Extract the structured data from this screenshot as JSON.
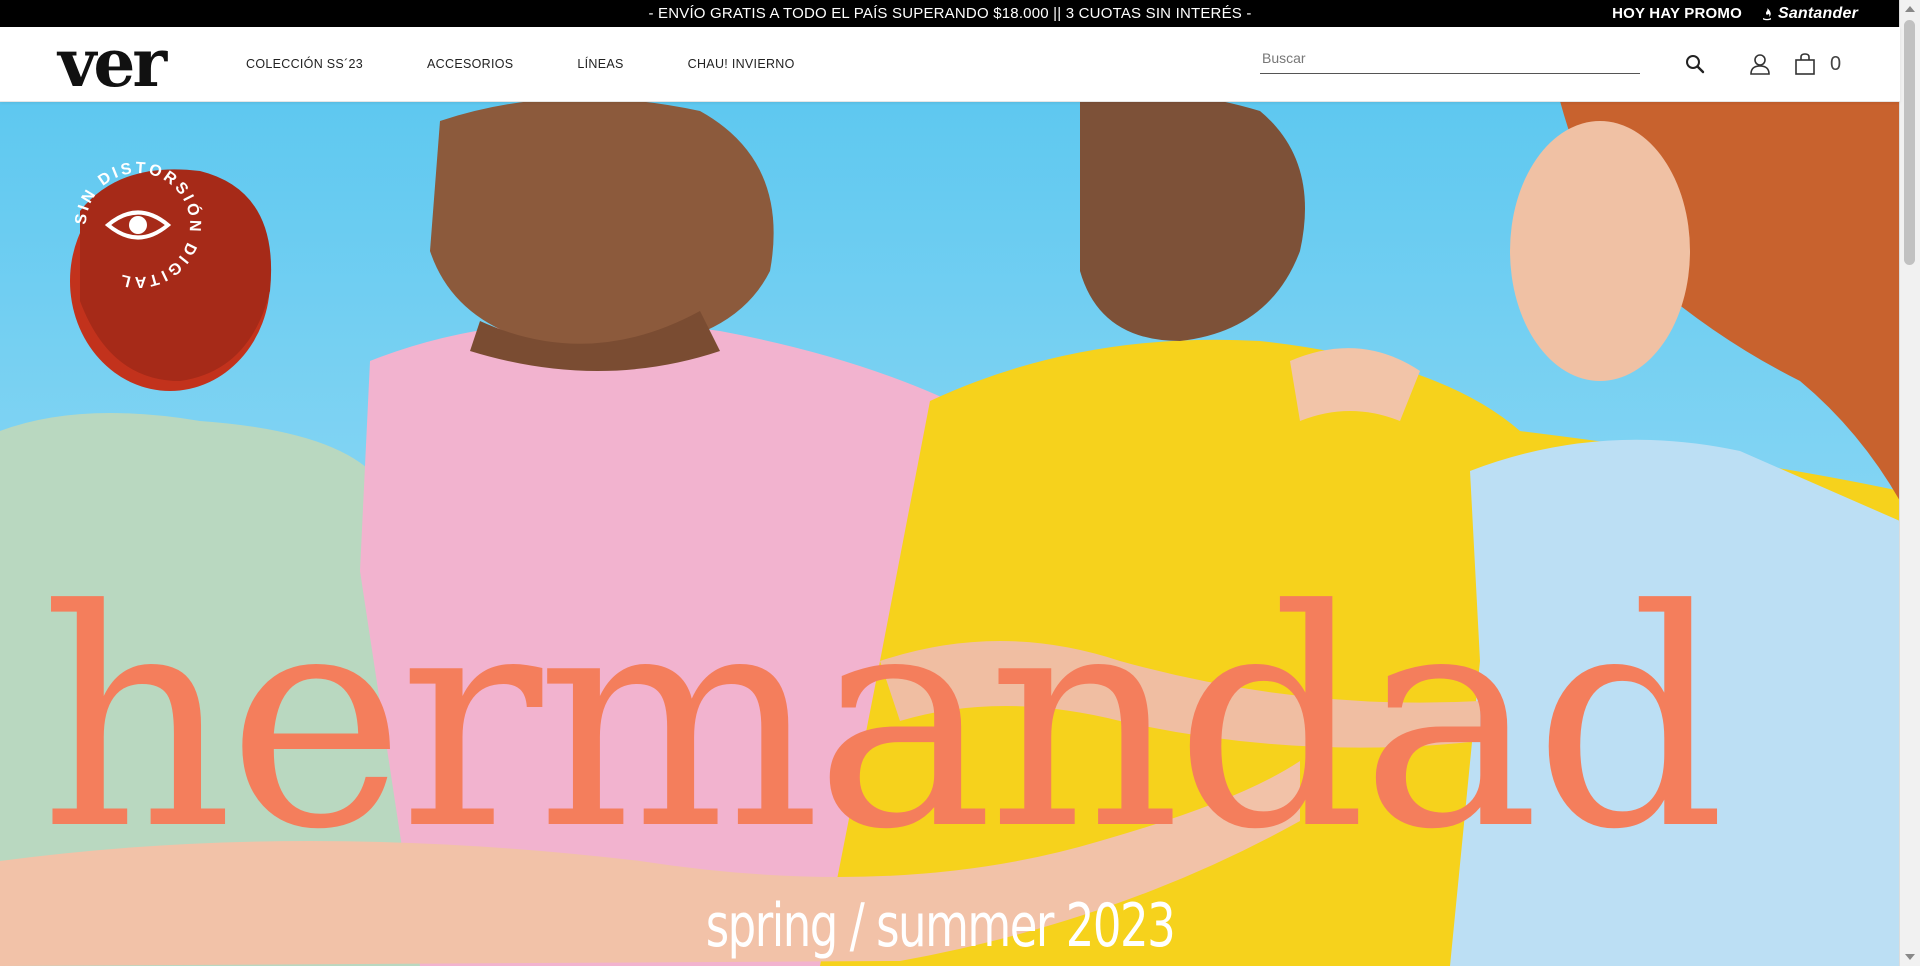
{
  "promo": {
    "message": "- ENVÍO GRATIS A TODO EL PAÍS SUPERANDO $18.000 || 3 CUOTAS SIN INTERÉS -",
    "promo_label": "HOY HAY PROMO",
    "bank": "Santander"
  },
  "header": {
    "logo": "ver",
    "nav": [
      {
        "label": "COLECCIÓN SS´23"
      },
      {
        "label": "ACCESORIOS"
      },
      {
        "label": "LÍNEAS"
      },
      {
        "label": "CHAU! INVIERNO"
      }
    ],
    "search_placeholder": "Buscar",
    "cart_count": "0"
  },
  "hero": {
    "title": "hermandad",
    "subtitle": "spring / summer 2023",
    "badge_text": "SIN DISTORSIÓN DIGITAL"
  },
  "colors": {
    "accent": "#f47e5c",
    "sky": "#5ec8f0",
    "pink": "#f2b3cf",
    "yellow": "#f6d21c",
    "mint": "#b9d8c0",
    "light_blue": "#bcdff4"
  },
  "icons": [
    "search-icon",
    "user-icon",
    "bag-icon",
    "eye-icon"
  ]
}
